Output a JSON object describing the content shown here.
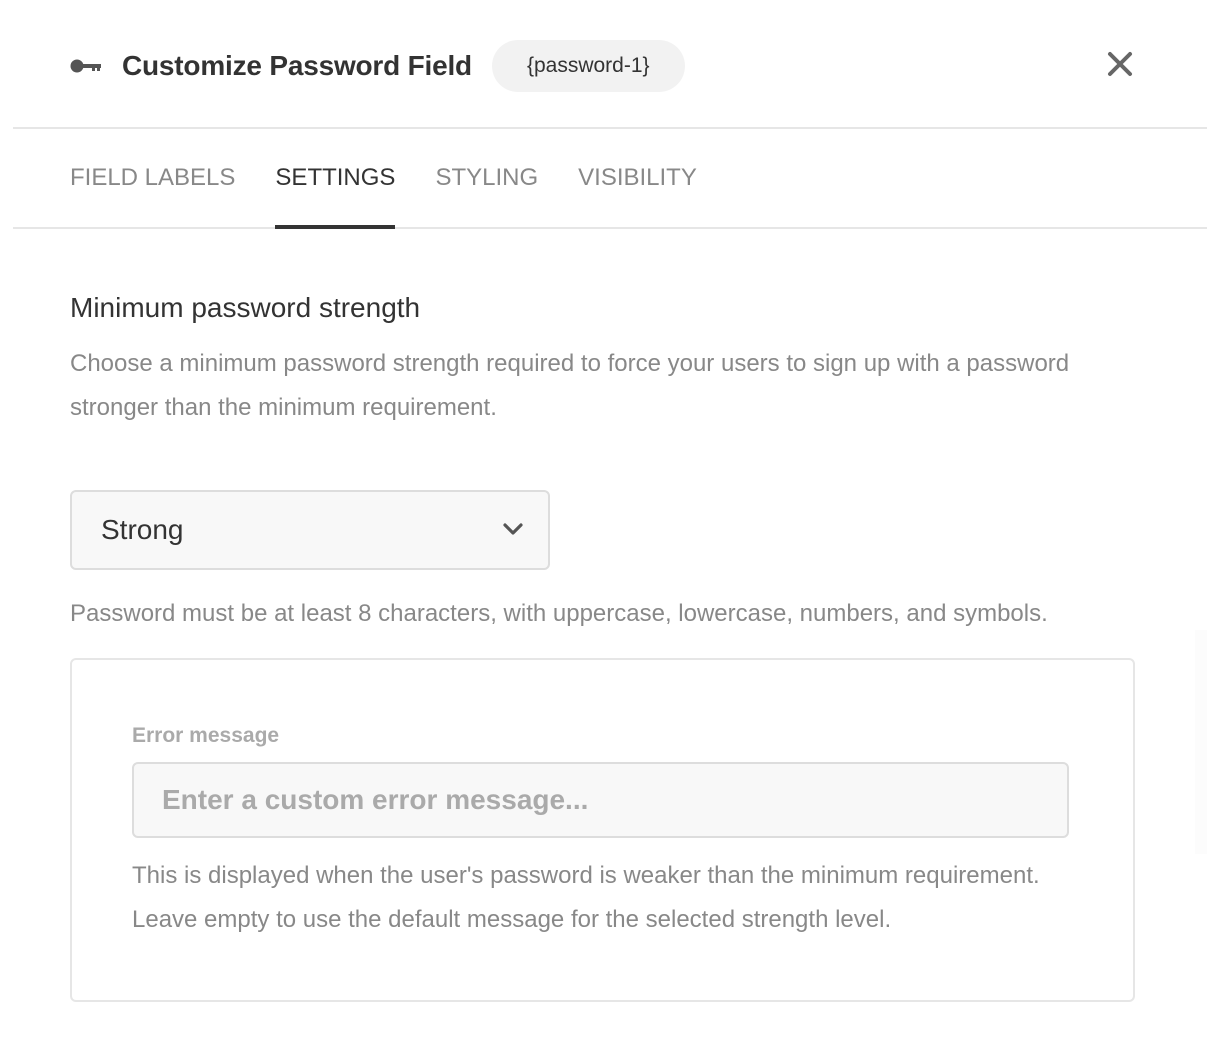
{
  "header": {
    "icon": "key-icon",
    "title": "Customize Password Field",
    "field_tag": "{password-1}",
    "close_icon": "close-icon"
  },
  "tabs": [
    {
      "label": "FIELD LABELS",
      "active": false
    },
    {
      "label": "SETTINGS",
      "active": true
    },
    {
      "label": "STYLING",
      "active": false
    },
    {
      "label": "VISIBILITY",
      "active": false
    }
  ],
  "settings": {
    "section_title": "Minimum password strength",
    "section_description": "Choose a minimum password strength required to force your users to sign up with a password stronger than the minimum requirement.",
    "strength_select": {
      "selected": "Strong",
      "icon": "chevron-down-icon"
    },
    "strength_hint": "Password must be at least 8 characters, with uppercase, lowercase, numbers, and symbols.",
    "error_message": {
      "label": "Error message",
      "value": "",
      "placeholder": "Enter a custom error message...",
      "help": "This is displayed when the user's password is weaker than the minimum requirement. Leave empty to use the default message for the selected strength level."
    }
  },
  "colors": {
    "text_primary": "#333333",
    "text_muted": "#888888",
    "border": "#e6e6e6",
    "input_bg": "#f8f8f8"
  }
}
